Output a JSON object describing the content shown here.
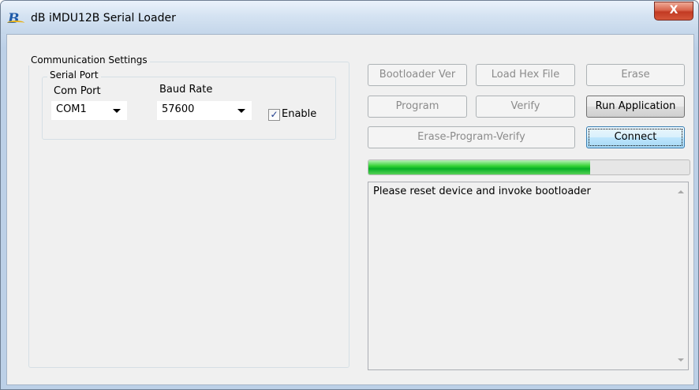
{
  "window": {
    "title": "dB iMDU12B Serial Loader",
    "close_glyph": "X",
    "app_icon": "dB-logo-icon",
    "app_icon_glyph": "B"
  },
  "communication": {
    "group_label": "Communication Settings",
    "serial_port": {
      "group_label": "Serial Port",
      "com_port_label": "Com Port",
      "com_port_value": "COM1",
      "baud_rate_label": "Baud Rate",
      "baud_rate_value": "57600",
      "enable_label": "Enable",
      "enable_checked": true,
      "check_glyph": "✓"
    }
  },
  "buttons": {
    "bootloader_ver": "Bootloader Ver",
    "load_hex_file": "Load Hex File",
    "erase": "Erase",
    "program": "Program",
    "verify": "Verify",
    "run_application": "Run Application",
    "erase_program_verify": "Erase-Program-Verify",
    "connect": "Connect"
  },
  "progress": {
    "value_fraction": 0.69,
    "color": "#06b025"
  },
  "log": {
    "text": "Please reset device and invoke bootloader"
  }
}
